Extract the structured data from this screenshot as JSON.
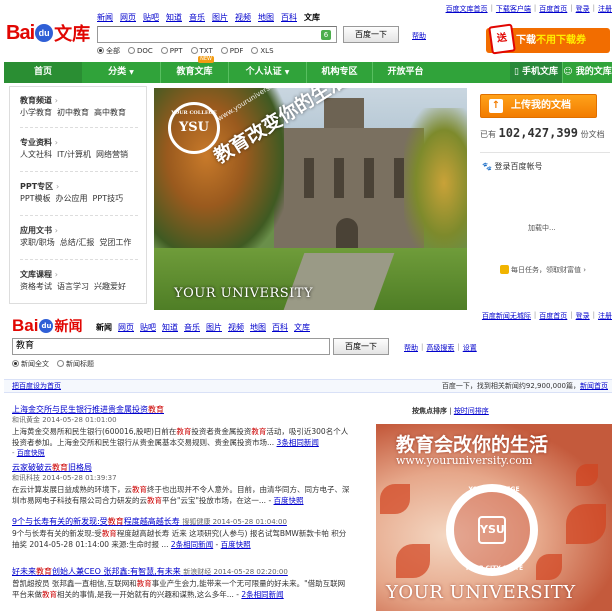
{
  "wenku": {
    "top_links": [
      "百度文库首页",
      "下载客户端",
      "百度首页",
      "登录",
      "注册"
    ],
    "logo_text": "文库",
    "logo_brand": "Bai",
    "logo_du": "du",
    "nav": [
      "新闻",
      "网页",
      "贴吧",
      "知道",
      "音乐",
      "图片",
      "视频",
      "地图",
      "百科",
      "文库"
    ],
    "nav_current": "文库",
    "search_value": "",
    "search_badge": "6",
    "search_button": "百度一下",
    "help": "帮助",
    "radio_options": [
      "全部",
      "DOC",
      "PPT",
      "TXT",
      "PDF",
      "XLS"
    ],
    "radio_selected": "全部",
    "promo_gift": "送",
    "promo_text_1": "下载",
    "promo_text_2": "不用下载券",
    "nav_bar": {
      "home": "首页",
      "category": "分类",
      "edu": "教育文库",
      "new_badge": "NEW",
      "cert": "个人认证",
      "org": "机构专区",
      "platform": "开放平台",
      "mobile": "手机文库",
      "mine": "我的文库"
    },
    "sidebar": [
      {
        "title": "教育频道",
        "links": [
          "小学教育",
          "初中教育",
          "高中教育"
        ]
      },
      {
        "title": "专业资料",
        "links": [
          "人文社科",
          "IT/计算机",
          "网络营销"
        ]
      },
      {
        "title": "PPT专区",
        "links": [
          "PPT模板",
          "办公应用",
          "PPT技巧"
        ]
      },
      {
        "title": "应用文书",
        "links": [
          "求职/职场",
          "总结/汇报",
          "党团工作"
        ]
      },
      {
        "title": "文库课程",
        "links": [
          "资格考试",
          "语言学习",
          "兴趣爱好"
        ]
      }
    ],
    "sidebar_arrow": "›",
    "banner": {
      "slogan": "教育改变你的生活",
      "url": "www.youruniversity.com",
      "seal_top": "YOUR COLLEGE",
      "seal_mid": "YSU",
      "footer": "YOUR UNIVERSITY"
    },
    "upload_icon": "↑",
    "upload_button": "上传我的文档",
    "doc_count_prefix": "已有",
    "doc_count": "102,427,399",
    "doc_count_suffix": "份文档",
    "login_title": "登录百度帐号",
    "loading": "加载中...",
    "task": "每日任务，领取财富值",
    "task_arrow": "›",
    "bottom_links": [
      "百度新闻无城际",
      "百度首页",
      "登录",
      "注册"
    ]
  },
  "news": {
    "logo_brand": "Bai",
    "logo_du": "du",
    "logo_text": "新闻",
    "nav": [
      "新闻",
      "网页",
      "贴吧",
      "知道",
      "音乐",
      "图片",
      "视频",
      "地图",
      "百科",
      "文库"
    ],
    "nav_current": "新闻",
    "search_value": "教育",
    "search_button": "百度一下",
    "help_links": [
      "帮助",
      "高级搜索",
      "设置"
    ],
    "radio_options": [
      "新闻全文",
      "新闻标题"
    ],
    "radio_selected": "新闻全文",
    "bar_left": "把百度设为首页",
    "bar_right_prefix": "百度一下，找到相关新闻约92,900,000篇，",
    "bar_right_link": "新闻首页",
    "sort_label": "按焦点排序",
    "sort_time": "按时间排序",
    "results": [
      {
        "title_pre": "上海金交所与民生银行推进贵金属投资",
        "title_em": "教育",
        "source": "和讯黄金 2014-05-28 01:01:00",
        "snippet_pre": "上海黄金交易所和民生银行(600016,股吧)日前在",
        "snippet_em": "教育",
        "snippet_post": "投资者贵金属投资",
        "snippet_em2": "教育",
        "snippet_post2": "活动，吸引近300名个人投资者参加。上海金交所和民生银行从贵金属基本交易规则、贵金属投资市场... ",
        "more": "3条相同新闻",
        "cache": "百度快照"
      },
      {
        "title_pre": "云家破破云",
        "title_em": "教育",
        "title_post": "旧格局",
        "source": "和讯科技 2014-05-28 01:39:37",
        "snippet_pre": "在云计算发展日益成熟的环境下，云",
        "snippet_em": "教育",
        "snippet_post": "终于也出现并不令人意外。目前，由清华同方、同方电子、深圳市易网电子科技有限公司合力研发的云",
        "snippet_em2": "教育",
        "snippet_post2": "平台\"云宝\"投放市场，在这一... ",
        "more": "",
        "cache": "百度快照"
      },
      {
        "title_pre": "9个与长寿有关的新发现:受",
        "title_em": "教育",
        "title_post": "程度越高越长寿",
        "source": "搜狐健康 2014-05-28 01:04:00",
        "snippet_pre": "9个与长寿有关的新发现:受",
        "snippet_em": "教育",
        "snippet_post": "程度越高越长寿 近来 这项研究(人参与) 报名试驾BMW新款卡帕 积分抽奖 2014-05-28 01:14:00 来源:生命时报 ... ",
        "more": "2条相同新闻",
        "cache": "百度快照"
      },
      {
        "title_pre": "好未来",
        "title_em": "教育",
        "title_post": "创始人兼CEO 张邦鑫:有智慧,有未来",
        "source": "新浪财经 2014-05-28 02:20:00",
        "snippet_pre": "曾凯超按员 张邦鑫一直相信,互联网和",
        "snippet_em": "教育",
        "snippet_post": "事业产生会力,能带来一个无可限量的好未来。\"借助互联网平台来做",
        "snippet_em2": "教育",
        "snippet_post2": "相关的事情,是我一开始就有的兴趣和谋熟,这么多年...",
        "more": "2条相同新闻",
        "cache": ""
      }
    ],
    "ad": {
      "slogan": "教育会改你的生活",
      "url": "www.youruniversity.com",
      "seal_top": "YOUR COLLEGE",
      "seal_mid": "YSU",
      "seal_bottom": "YOUR CITY STATE",
      "footer": "YOUR UNIVERSITY"
    }
  },
  "colors": {
    "green_nav": "#30a33a",
    "baidu_red": "#e10602",
    "baidu_blue": "#2f5fd6",
    "link": "#0000cc",
    "highlight": "#cc0000",
    "orange": "#f27c00"
  }
}
